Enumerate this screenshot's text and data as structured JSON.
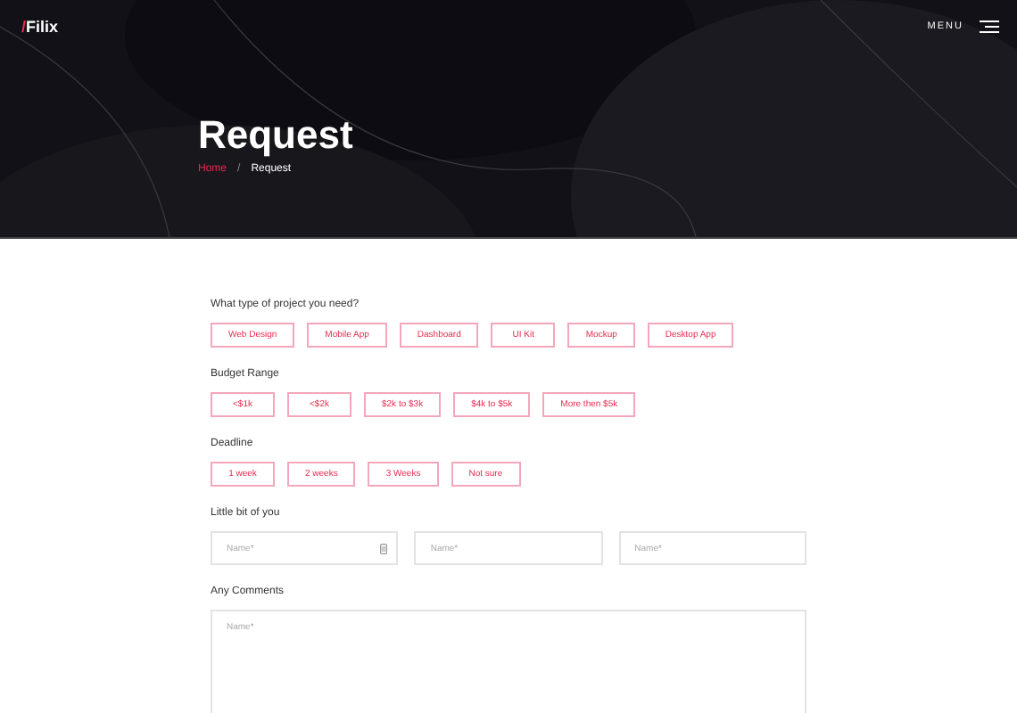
{
  "header": {
    "logo_slash": "/",
    "logo": "Filix",
    "menu": "MENU"
  },
  "hero": {
    "title": "Request",
    "breadcrumb": [
      {
        "label": "Home",
        "selected": false
      },
      {
        "label": "Request",
        "selected": true
      }
    ],
    "separator": "/"
  },
  "sections": [
    {
      "kind": "chips",
      "label": "What type of project you need?",
      "options": [
        "Web Design",
        "Mobile App",
        "Dashboard",
        "UI Kit",
        "Mockup",
        "Desktop App"
      ]
    },
    {
      "kind": "chips",
      "label": "Budget Range",
      "options": [
        "<$1k",
        "<$2k",
        "$2k to $3k",
        "$4k to $5k",
        "More then $5k"
      ]
    },
    {
      "kind": "chips",
      "label": "Deadline",
      "options": [
        "1 week",
        "2 weeks",
        "3 Weeks",
        "Not sure"
      ]
    },
    {
      "kind": "fields",
      "label": "Little bit of you",
      "fields": [
        {
          "placeholder": "Name*",
          "icon": true
        },
        {
          "placeholder": "Name*",
          "icon": false
        },
        {
          "placeholder": "Name*",
          "icon": false
        }
      ]
    },
    {
      "kind": "textarea",
      "label": "Any Comments",
      "placeholder": "Name*"
    }
  ]
}
